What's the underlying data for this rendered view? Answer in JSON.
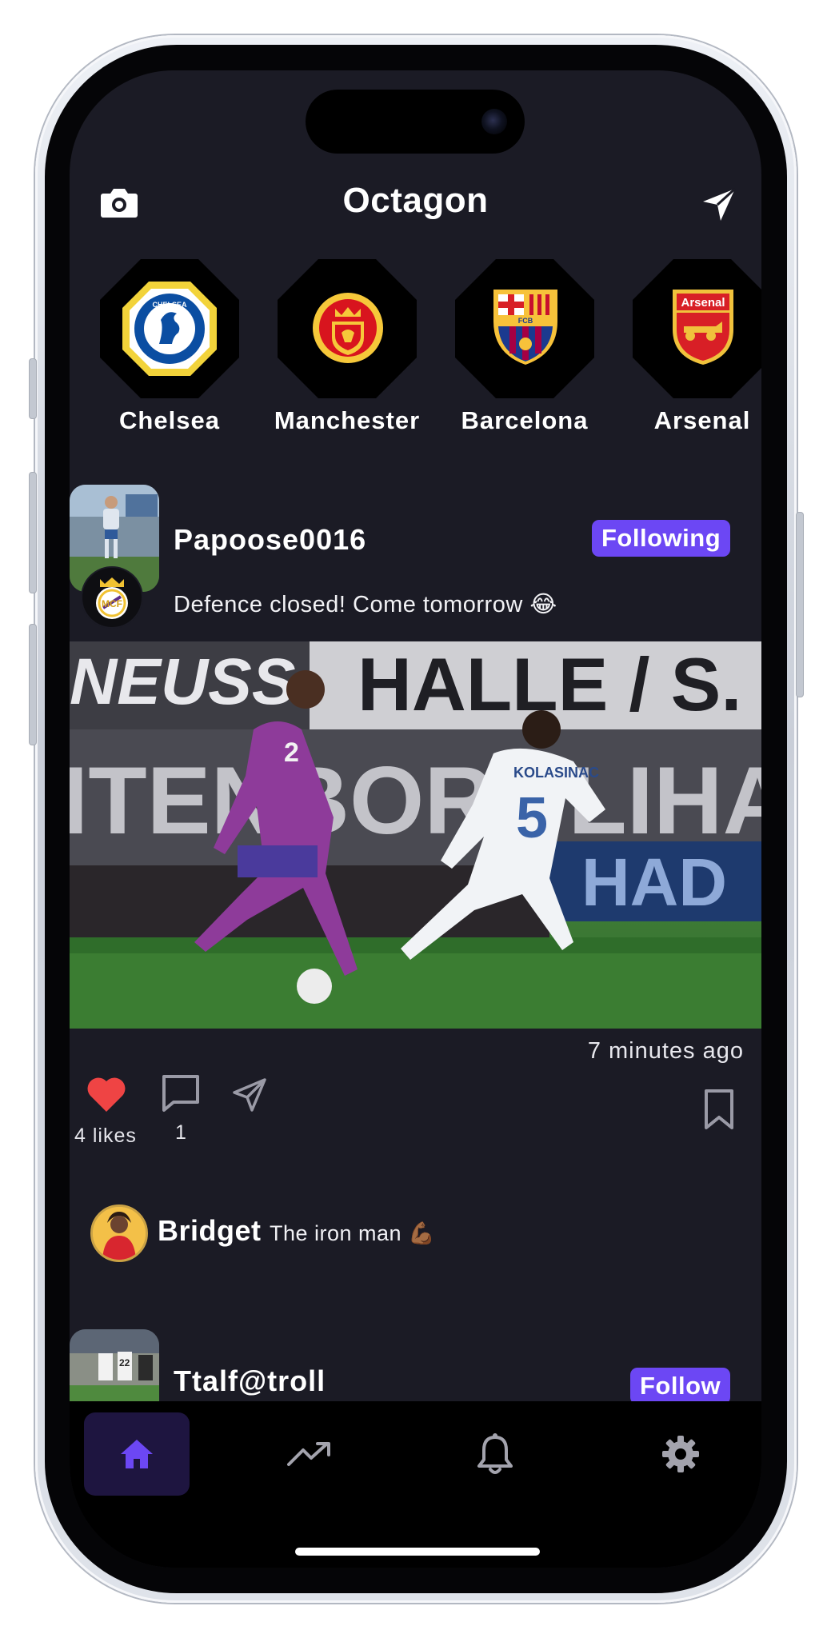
{
  "app": {
    "title": "Octagon"
  },
  "teams": [
    {
      "name": "Chelsea",
      "logo": "chelsea-badge-icon",
      "colors": [
        "#f2d33a",
        "#0b4ea2"
      ]
    },
    {
      "name": "Manchester",
      "logo": "manchester-united-badge-icon",
      "colors": [
        "#d8141e",
        "#f6c83a"
      ]
    },
    {
      "name": "Barcelona",
      "logo": "barcelona-badge-icon",
      "colors": [
        "#1b3a8f",
        "#a50044",
        "#f7c23a"
      ]
    },
    {
      "name": "Arsenal",
      "logo": "arsenal-badge-icon",
      "colors": [
        "#d81f26",
        "#f0c23c"
      ]
    }
  ],
  "post": {
    "username": "Papoose0016",
    "follow_label": "Following",
    "caption": "Defence closed! Come tomorrow 😂",
    "time": "7 minutes ago",
    "likes": "4 likes",
    "comments": "1",
    "liked": true,
    "image": {
      "banner_left": "NEUSS",
      "banner_right": "HALLE / S.",
      "banner_row2": "ITENBOROLIHA",
      "banner_row3": "HAD",
      "player1_number": "2",
      "player2_name": "KOLASINAC",
      "player2_number": "5"
    }
  },
  "comment": {
    "user": "Bridget",
    "text": "The iron man 💪🏾"
  },
  "post2": {
    "username": "Ttalf@troll",
    "follow_label": "Follow",
    "avatar_number": "22"
  },
  "tabbar": {
    "items": [
      {
        "icon": "home-icon",
        "active": true
      },
      {
        "icon": "trending-icon",
        "active": false
      },
      {
        "icon": "bell-icon",
        "active": false
      },
      {
        "icon": "gear-icon",
        "active": false
      }
    ]
  },
  "colors": {
    "accent": "#6c47f4",
    "like": "#ef4444",
    "background": "#1b1b25",
    "tabbar": "#000000"
  }
}
